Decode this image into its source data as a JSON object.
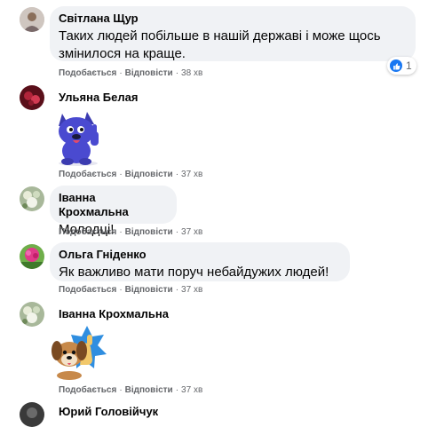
{
  "comments": [
    {
      "author": "Світлана Щур",
      "text_line1": "Таких людей побільше в нашій державі і може щось",
      "text_line2": "змінилося на краще.",
      "like_label": "Подобається",
      "reply_label": "Відповісти",
      "time": "38 хв",
      "reaction_count": "1",
      "reaction_icon": "like-icon"
    },
    {
      "author": "Ульяна Белая",
      "sticker": "blue-dog-thumbs-up-sticker",
      "like_label": "Подобається",
      "reply_label": "Відповісти",
      "time": "37 хв"
    },
    {
      "author": "Іванна Крохмальна",
      "text": "Молодці!",
      "like_label": "Подобається",
      "reply_label": "Відповісти",
      "time": "37 хв"
    },
    {
      "author": "Ольга Гніденко",
      "text": "Як важливо мати поруч небайдужих людей!",
      "like_label": "Подобається",
      "reply_label": "Відповісти",
      "time": "37 хв"
    },
    {
      "author": "Іванна Крохмальна",
      "sticker": "puppy-thumbs-up-sticker",
      "like_label": "Подобається",
      "reply_label": "Відповісти",
      "time": "37 хв"
    },
    {
      "author": "Юрий Головійчук"
    }
  ],
  "separator": "·",
  "colors": {
    "bubble": "#f0f2f5",
    "meta": "#65676b",
    "like_blue": "#1877f2"
  }
}
